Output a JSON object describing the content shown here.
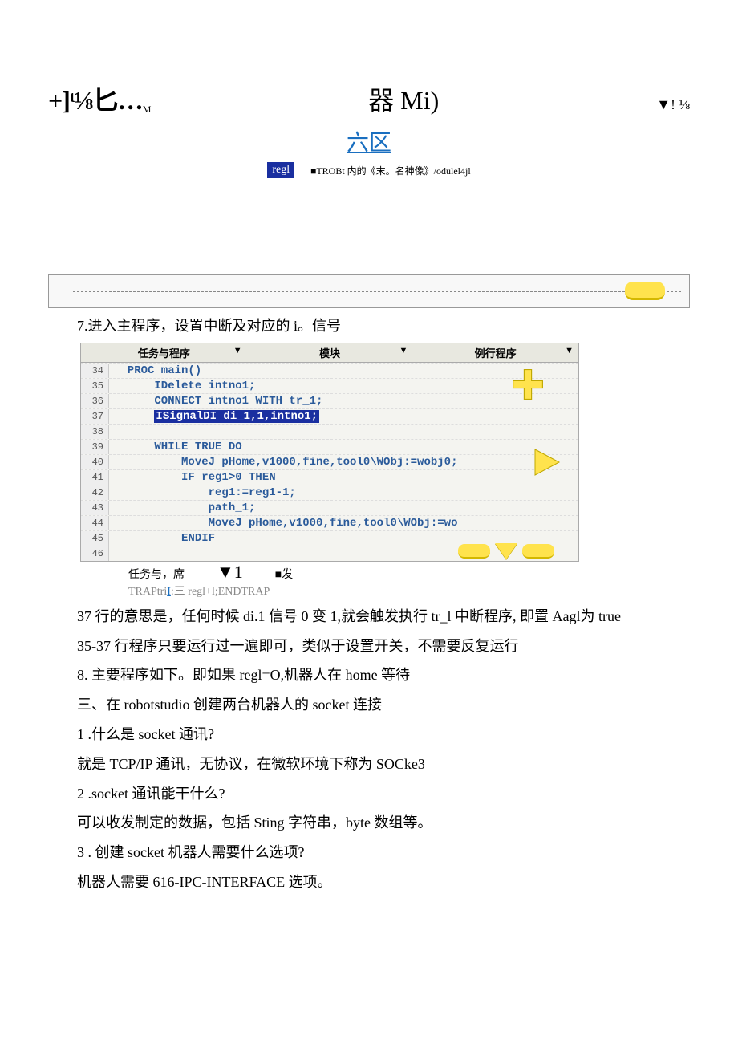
{
  "header": {
    "left_main": "+]ᵗ⅛匕…",
    "left_sub": "M",
    "mid": "器 Mi)",
    "right": "▼! ⅛"
  },
  "link_area": {
    "title": "六区",
    "regl": "regl",
    "trob": "■TROBt 内的《末。名神像》/odulel4jl"
  },
  "section7": "7.进入主程序，设置中断及对应的 i。信号",
  "tabs": {
    "t1": "任务与程序",
    "t2": "模块",
    "t3": "例行程序"
  },
  "code": {
    "l34": {
      "n": "34",
      "t": "  PROC main()"
    },
    "l35": {
      "n": "35",
      "t": "      IDelete intno1;"
    },
    "l36": {
      "n": "36",
      "t": "      CONNECT intno1 WITH tr_1;"
    },
    "l37": {
      "n": "37",
      "t": "      ",
      "hl": "ISignalDI di_1,1,intno1;"
    },
    "l38": {
      "n": "38",
      "t": ""
    },
    "l39": {
      "n": "39",
      "t": "      WHILE TRUE DO"
    },
    "l40": {
      "n": "40",
      "t": "          MoveJ pHome,v1000,fine,tool0\\WObj:=wobj0;"
    },
    "l41": {
      "n": "41",
      "t": "          IF reg1>0 THEN"
    },
    "l42": {
      "n": "42",
      "t": "              reg1:=reg1-1;"
    },
    "l43": {
      "n": "43",
      "t": "              path_1;"
    },
    "l44": {
      "n": "44",
      "t": "              MoveJ pHome,v1000,fine,tool0\\WObj:=wo"
    },
    "l45": {
      "n": "45",
      "t": "          ENDIF"
    },
    "l46": {
      "n": "46",
      "t": ""
    }
  },
  "mini": {
    "a": "任务与，席",
    "b": "▼1",
    "c": "■发"
  },
  "trap": {
    "a": "TRAPtri",
    "b": "I",
    "c": ":三 regl+l;ENDTRAP"
  },
  "paras": {
    "p1": "37 行的意思是，任何时候 di.1 信号 0 变 1,就会触发执行 tr_l 中断程序, 即置 Aagl为 true",
    "p2": "35-37 行程序只要运行过一遍即可，类似于设置开关，不需要反复运行",
    "p3": "8. 主要程序如下。即如果 regl=O,机器人在 home 等待",
    "p4": "三、在 robotstudio 创建两台机器人的 socket 连接",
    "p5": "1 .什么是 socket 通讯?",
    "p6": "就是 TCP/IP 通讯，无协议，在微软环境下称为 SOCke3",
    "p7": "2  .socket 通讯能干什么?",
    "p8": "可以收发制定的数据，包括 Sting 字符串，byte 数组等。",
    "p9": "3  . 创建 socket 机器人需要什么选项?",
    "p10": "机器人需要 616-IPC-INTERFACE 选项。"
  }
}
